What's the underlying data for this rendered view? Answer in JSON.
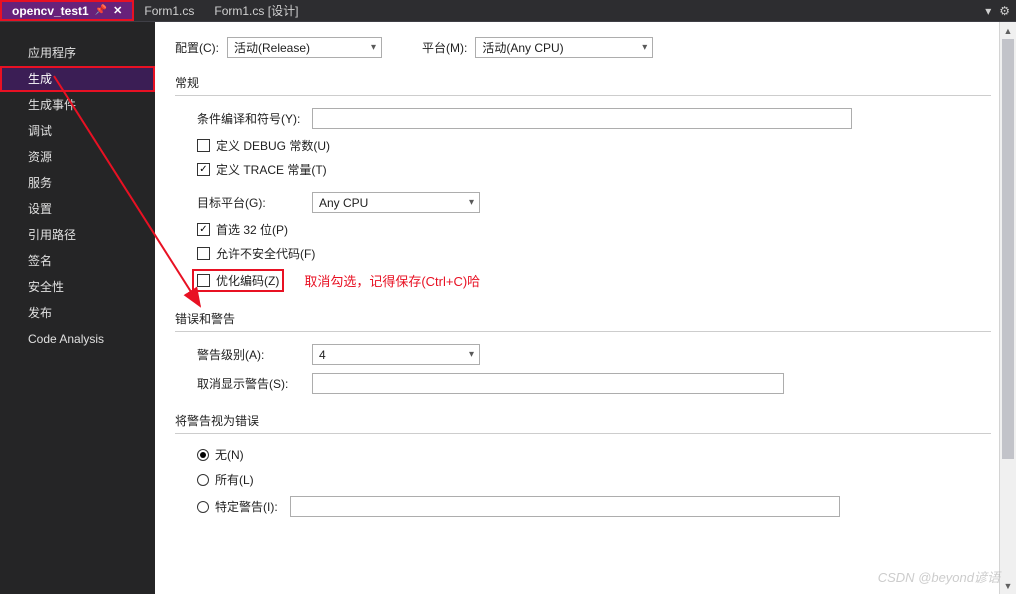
{
  "tabs": {
    "active": "opencv_test1",
    "items": [
      "Form1.cs",
      "Form1.cs [设计]"
    ]
  },
  "right_icons": {
    "dropdown": "▾",
    "gear": "⚙"
  },
  "sidebar": {
    "items": [
      "应用程序",
      "生成",
      "生成事件",
      "调试",
      "资源",
      "服务",
      "设置",
      "引用路径",
      "签名",
      "安全性",
      "发布",
      "Code Analysis"
    ]
  },
  "top": {
    "config_label": "配置(C):",
    "config_value": "活动(Release)",
    "platform_label": "平台(M):",
    "platform_value": "活动(Any CPU)"
  },
  "general": {
    "title": "常规",
    "cond_compile_label": "条件编译和符号(Y):",
    "cond_compile_value": "",
    "define_debug": "定义 DEBUG 常数(U)",
    "define_trace": "定义 TRACE 常量(T)",
    "target_platform_label": "目标平台(G):",
    "target_platform_value": "Any CPU",
    "prefer_32bit": "首选 32 位(P)",
    "allow_unsafe": "允许不安全代码(F)",
    "optimize_code": "优化编码(Z)",
    "annotation": "取消勾选，记得保存(Ctrl+C)哈"
  },
  "errors": {
    "title": "错误和警告",
    "warn_level_label": "警告级别(A):",
    "warn_level_value": "4",
    "suppress_label": "取消显示警告(S):",
    "suppress_value": ""
  },
  "treat_warnings": {
    "title": "将警告视为错误",
    "none": "无(N)",
    "all": "所有(L)",
    "specific": "特定警告(I):",
    "specific_value": ""
  },
  "watermark": "CSDN @beyond谚语"
}
